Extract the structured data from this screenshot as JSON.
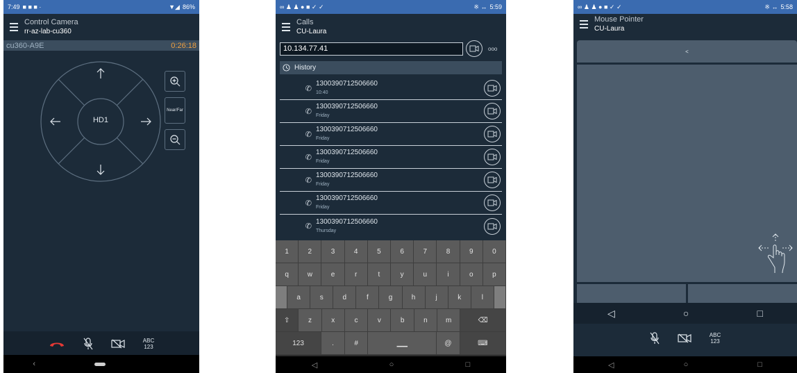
{
  "colors": {
    "statusbar": "#3a6bb0",
    "background": "#1c2b39",
    "timer": "#f0a040",
    "hangup": "#e53935"
  },
  "phone1": {
    "status": {
      "time": "7:49",
      "battery": "86%"
    },
    "title": "Control Camera",
    "subtitle": "rr-az-lab-cu360",
    "device": "cu360-A9E",
    "timer": "0:26:18",
    "dpad_center": "HD1",
    "near_far": "Near/Far",
    "abc": "ABC",
    "num": "123",
    "icons": [
      "menu-icon",
      "arrow-up-icon",
      "arrow-down-icon",
      "arrow-left-icon",
      "arrow-right-icon",
      "zoom-in-icon",
      "zoom-out-icon",
      "hangup-icon",
      "mic-off-icon",
      "video-off-icon",
      "nav-back-icon",
      "nav-home-icon"
    ]
  },
  "phone2": {
    "status": {
      "time": "5:59"
    },
    "title": "Calls",
    "subtitle": "CU-Laura",
    "address": "10.134.77.41",
    "more": "ooo",
    "history_label": "History",
    "calls": [
      {
        "number": "1300390712506660",
        "when": "10:40"
      },
      {
        "number": "1300390712506660",
        "when": "Friday"
      },
      {
        "number": "1300390712506660",
        "when": "Friday"
      },
      {
        "number": "1300390712506660",
        "when": "Friday"
      },
      {
        "number": "1300390712506660",
        "when": "Friday"
      },
      {
        "number": "1300390712506660",
        "when": "Friday"
      },
      {
        "number": "1300390712506660",
        "when": "Thursday"
      }
    ],
    "keyboard": {
      "row1": [
        "1",
        "2",
        "3",
        "4",
        "5",
        "6",
        "7",
        "8",
        "9",
        "0"
      ],
      "row2": [
        "q",
        "w",
        "e",
        "r",
        "t",
        "y",
        "u",
        "i",
        "o",
        "p"
      ],
      "row3": [
        "a",
        "s",
        "d",
        "f",
        "g",
        "h",
        "j",
        "k",
        "l"
      ],
      "row4": [
        "z",
        "x",
        "c",
        "v",
        "b",
        "n",
        "m"
      ],
      "row5": [
        "123",
        ".",
        "#",
        "@"
      ]
    }
  },
  "phone3": {
    "status": {
      "time": "5:58"
    },
    "title": "Mouse Pointer",
    "subtitle": "CU-Laura",
    "scroll_arrow": "<",
    "abc": "ABC",
    "num": "123"
  }
}
